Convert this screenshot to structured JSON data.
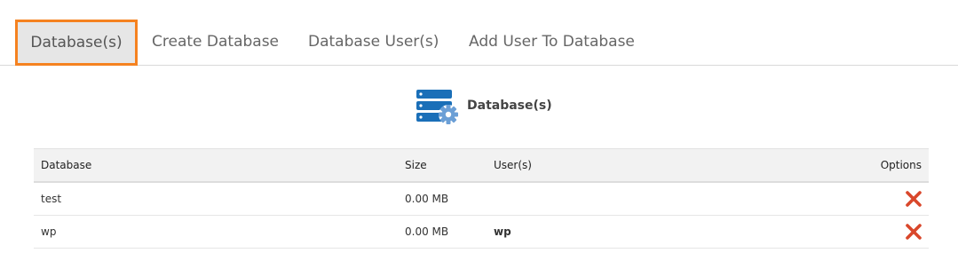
{
  "tabs": [
    {
      "label": "Database(s)",
      "active": true
    },
    {
      "label": "Create Database",
      "active": false
    },
    {
      "label": "Database User(s)",
      "active": false
    },
    {
      "label": "Add User To Database",
      "active": false
    }
  ],
  "panel": {
    "title": "Database(s)",
    "icon": "database-gear-icon"
  },
  "table": {
    "headers": {
      "database": "Database",
      "size": "Size",
      "users": "User(s)",
      "options": "Options"
    },
    "rows": [
      {
        "database": "test",
        "size": "0.00 MB",
        "users": ""
      },
      {
        "database": "wp",
        "size": "0.00 MB",
        "users": "wp"
      }
    ],
    "delete_icon": "delete-x-icon"
  },
  "colors": {
    "active_tab_border": "#f58220",
    "icon_blue": "#1a6fb8",
    "icon_gear": "#6b9fd6",
    "delete_red": "#d9472b"
  }
}
